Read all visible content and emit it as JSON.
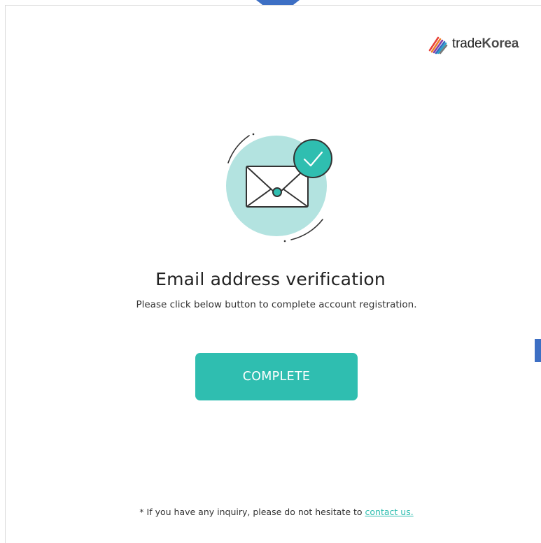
{
  "brand": {
    "name_part1": "trade",
    "name_part2": "Korea",
    "logo_icon": "tradekorea-stripes-logo"
  },
  "illustration": {
    "icon": "envelope-checkmark-icon"
  },
  "content": {
    "title": "Email address verification",
    "subtitle": "Please click below button to complete account registration.",
    "complete_label": "COMPLETE"
  },
  "footer": {
    "note_prefix": "* If you have any inquiry, please do not hesitate to ",
    "contact_link": "contact us."
  },
  "colors": {
    "accent": "#2fbeb0",
    "marker": "#3d6fc4",
    "circle": "#b3e3e0"
  }
}
